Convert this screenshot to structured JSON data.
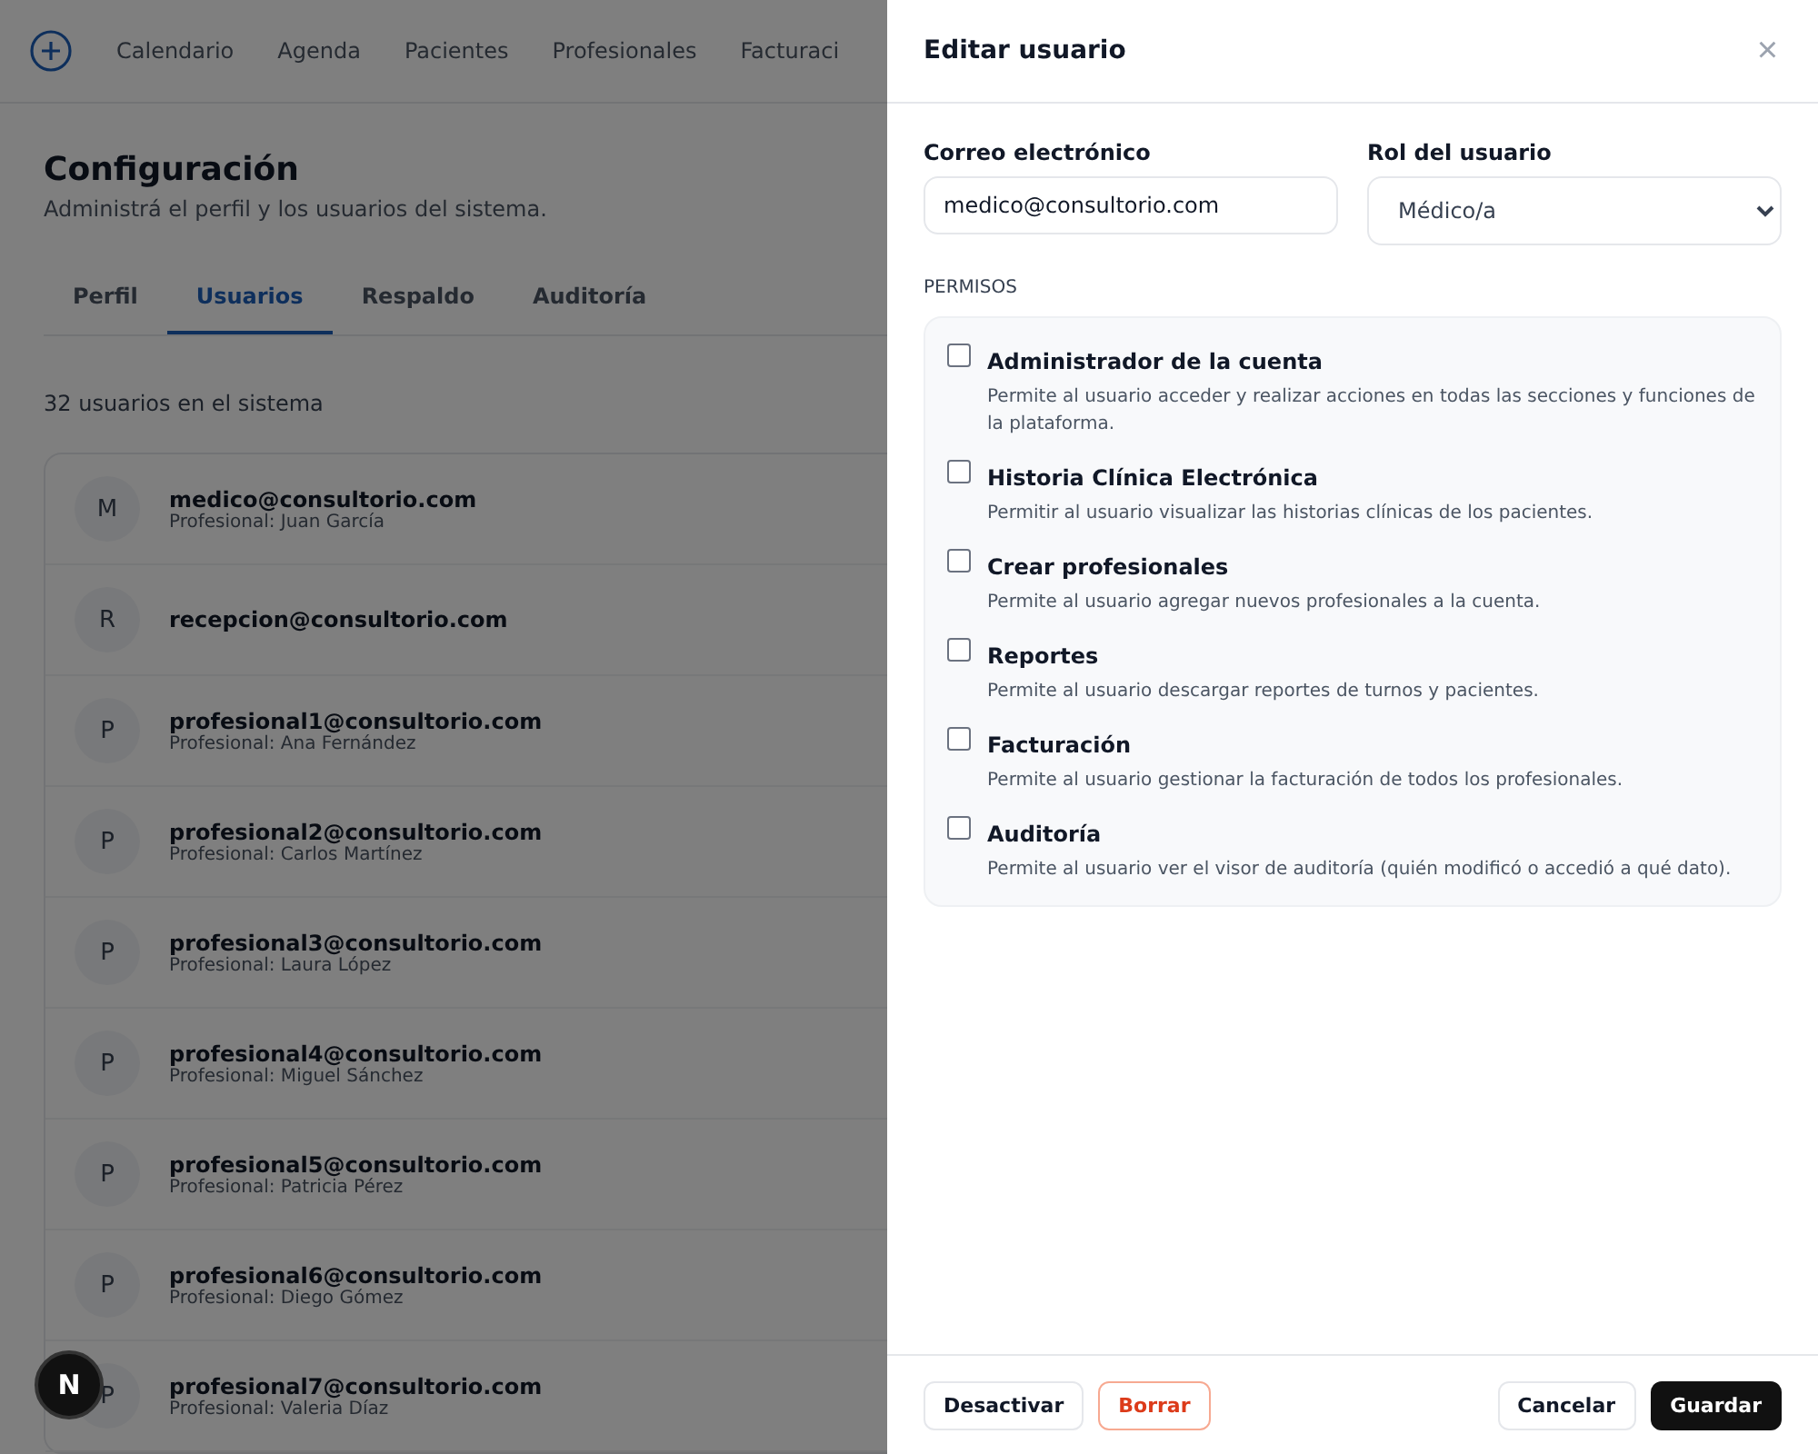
{
  "nav": {
    "items": [
      "Calendario",
      "Agenda",
      "Pacientes",
      "Profesionales",
      "Facturaci"
    ]
  },
  "page": {
    "title": "Configuración",
    "subtitle": "Administrá el perfil y los usuarios del sistema.",
    "tabs": [
      {
        "label": "Perfil",
        "selected": false
      },
      {
        "label": "Usuarios",
        "selected": true
      },
      {
        "label": "Respaldo",
        "selected": false
      },
      {
        "label": "Auditoría",
        "selected": false
      }
    ],
    "count": "32 usuarios en el sistema",
    "users": [
      {
        "initial": "M",
        "email": "medico@consultorio.com",
        "detail": "Profesional: Juan García"
      },
      {
        "initial": "R",
        "email": "recepcion@consultorio.com"
      },
      {
        "initial": "P",
        "email": "profesional1@consultorio.com",
        "detail": "Profesional: Ana Fernández"
      },
      {
        "initial": "P",
        "email": "profesional2@consultorio.com",
        "detail": "Profesional: Carlos Martínez"
      },
      {
        "initial": "P",
        "email": "profesional3@consultorio.com",
        "detail": "Profesional: Laura López"
      },
      {
        "initial": "P",
        "email": "profesional4@consultorio.com",
        "detail": "Profesional: Miguel Sánchez"
      },
      {
        "initial": "P",
        "email": "profesional5@consultorio.com",
        "detail": "Profesional: Patricia Pérez"
      },
      {
        "initial": "P",
        "email": "profesional6@consultorio.com",
        "detail": "Profesional: Diego Gómez"
      },
      {
        "initial": "P",
        "email": "profesional7@consultorio.com",
        "detail": "Profesional: Valeria Díaz"
      }
    ]
  },
  "dev_badge": "N",
  "drawer": {
    "title": "Editar usuario",
    "close": "×",
    "email_label": "Correo electrónico",
    "email_value": "medico@consultorio.com",
    "role_label": "Rol del usuario",
    "role_value": "Médico/a",
    "permissions_heading": "PERMISOS",
    "permissions": [
      {
        "label": "Administrador de la cuenta",
        "description": "Permite al usuario acceder y realizar acciones en todas las secciones y funciones de la plataforma.",
        "checked": false
      },
      {
        "label": "Historia Clínica Electrónica",
        "description": "Permitir al usuario visualizar las historias clínicas de los pacientes.",
        "checked": false
      },
      {
        "label": "Crear profesionales",
        "description": "Permite al usuario agregar nuevos profesionales a la cuenta.",
        "checked": false
      },
      {
        "label": "Reportes",
        "description": "Permite al usuario descargar reportes de turnos y pacientes.",
        "checked": false
      },
      {
        "label": "Facturación",
        "description": "Permite al usuario gestionar la facturación de todos los profesionales.",
        "checked": false
      },
      {
        "label": "Auditoría",
        "description": "Permite al usuario ver el visor de auditoría (quién modificó o accedió a qué dato).",
        "checked": false
      }
    ],
    "buttons": [
      {
        "label": "Desactivar",
        "kind": "secondary"
      },
      {
        "label": "Borrar",
        "kind": "danger"
      },
      {
        "label": "Cancelar",
        "kind": "secondary"
      },
      {
        "label": "Guardar",
        "kind": "primary"
      }
    ]
  }
}
